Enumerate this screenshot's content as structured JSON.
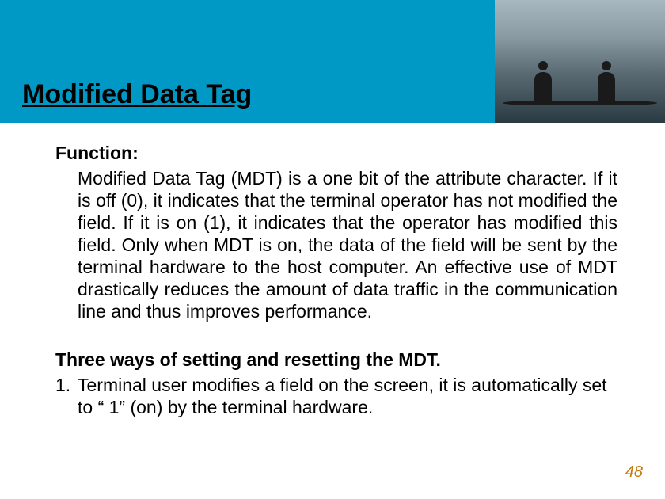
{
  "title": "Modified Data Tag",
  "function_label": "Function:",
  "function_text": "Modified Data Tag (MDT) is a one bit of the attribute character. If it is off (0), it indicates that the terminal operator has not modified the field. If it is on (1), it indicates that the operator has modified this field. Only when MDT is on, the data of the field will be sent by the terminal hardware to the host computer.  An effective use of MDT drastically reduces the amount of data traffic in the communication line and thus improves performance.",
  "ways_label": "Three ways of setting and resetting the MDT.",
  "ways_item_num": "1.",
  "ways_item_text": "Terminal user modifies a field on the screen, it is automatically set to “ 1” (on) by the terminal hardware.",
  "page_number": "48"
}
